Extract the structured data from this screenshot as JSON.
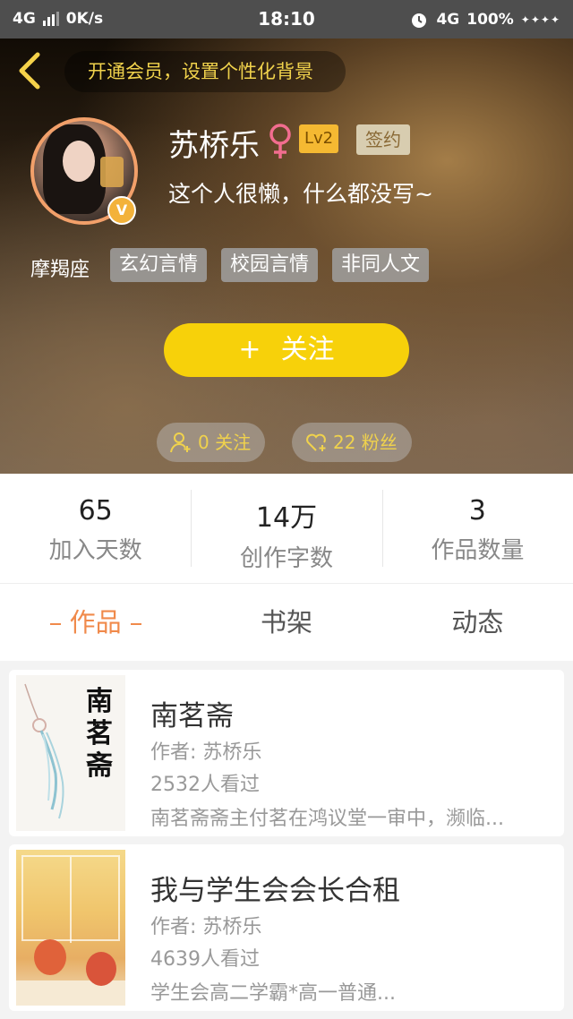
{
  "status_bar": {
    "network_left": "4G",
    "speed": "0K/s",
    "time": "18:10",
    "network_right": "4G",
    "battery": "100%"
  },
  "header": {
    "vip_banner": "开通会员，设置个性化背景",
    "username": "苏桥乐",
    "level": "Lv2",
    "sign_badge": "签约",
    "avatar_badge": "V",
    "bio": "这个人很懒，什么都没写~",
    "zodiac": "摩羯座",
    "tags": [
      "玄幻言情",
      "校园言情",
      "非同人文"
    ],
    "follow_label": "关注",
    "follow_plus": "+",
    "following": "0 关注",
    "followers": "22 粉丝"
  },
  "stats": [
    {
      "value": "65",
      "label": "加入天数"
    },
    {
      "value": "14万",
      "label": "创作字数"
    },
    {
      "value": "3",
      "label": "作品数量"
    }
  ],
  "tabs": [
    "作品",
    "书架",
    "动态"
  ],
  "works": [
    {
      "title": "南茗斋",
      "author": "作者: 苏桥乐",
      "views": "2532人看过",
      "desc": "南茗斋斋主付茗在鸿议堂一审中，濒临...",
      "cover_text": "南茗斋"
    },
    {
      "title": "我与学生会会长合租",
      "author": "作者: 苏桥乐",
      "views": "4639人看过",
      "desc": "学生会高二学霸*高一普通..."
    }
  ],
  "colors": {
    "accent": "#f08a4b",
    "follow_button": "#f7d10a",
    "gold_text": "#f0d24c"
  }
}
